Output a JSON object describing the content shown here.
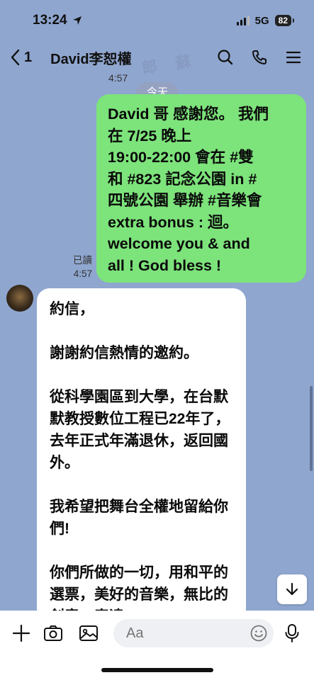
{
  "status": {
    "time": "13:24",
    "network": "5G",
    "battery": "82"
  },
  "header": {
    "back_count": "1",
    "title": "David李恕權"
  },
  "watermark": "郎 蘇",
  "chat": {
    "prev_time": "4:57",
    "date_chip": "今天",
    "outgoing": {
      "text": "David 哥 感謝您。 我們\n在 7/25 晚上\n19:00-22:00 會在 #雙\n和 #823 記念公園 in #\n四號公園 舉辦 #音樂會\nextra bonus : 迴。\nwelcome you & and\nall ! God bless !",
      "read_label": "已讀",
      "time": "4:57"
    },
    "incoming": {
      "paragraphs": [
        "約信，",
        "謝謝約信熱情的邀約。",
        "從科學園區到大學，在台默默教授數位工程已22年了，去年正式年滿退休，返回國外。",
        "我希望把舞台全權地留給你們!",
        "你們所做的一切，用和平的選票，美好的音樂，無比的創意，表達"
      ]
    }
  },
  "input": {
    "placeholder": "Aa"
  }
}
